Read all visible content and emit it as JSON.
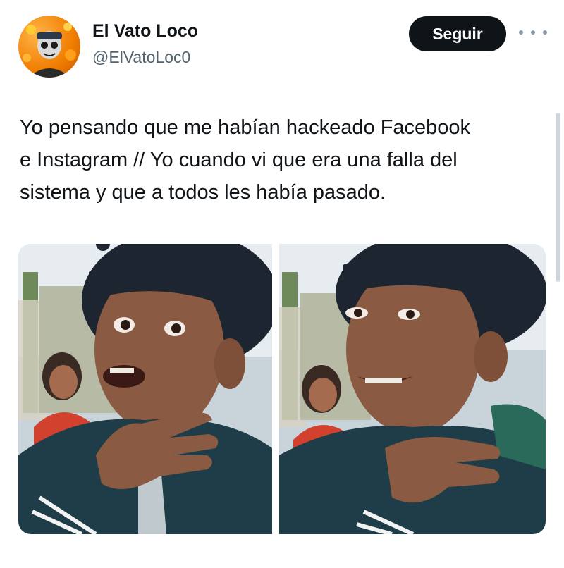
{
  "author": {
    "display_name": "El Vato Loco",
    "handle": "@ElVatoLoc0",
    "avatar_icon": "skull-face-avatar"
  },
  "actions": {
    "follow_label": "Seguir",
    "more_icon": "ellipsis-icon"
  },
  "tweet": {
    "text_line_1": "Yo pensando que me habían hackeado Facebook",
    "text_line_2": "e Instagram // Yo cuando vi que era una falla del",
    "text_line_3": "sistema y que a todos les había pasado."
  },
  "media": {
    "left_photo": "boy-shocked-hand-on-chest",
    "right_photo": "boy-relieved-smiling-hand-on-chest"
  },
  "colors": {
    "text": "#0f1419",
    "secondary": "#536471",
    "button_bg": "#0f1419",
    "button_text": "#ffffff"
  }
}
